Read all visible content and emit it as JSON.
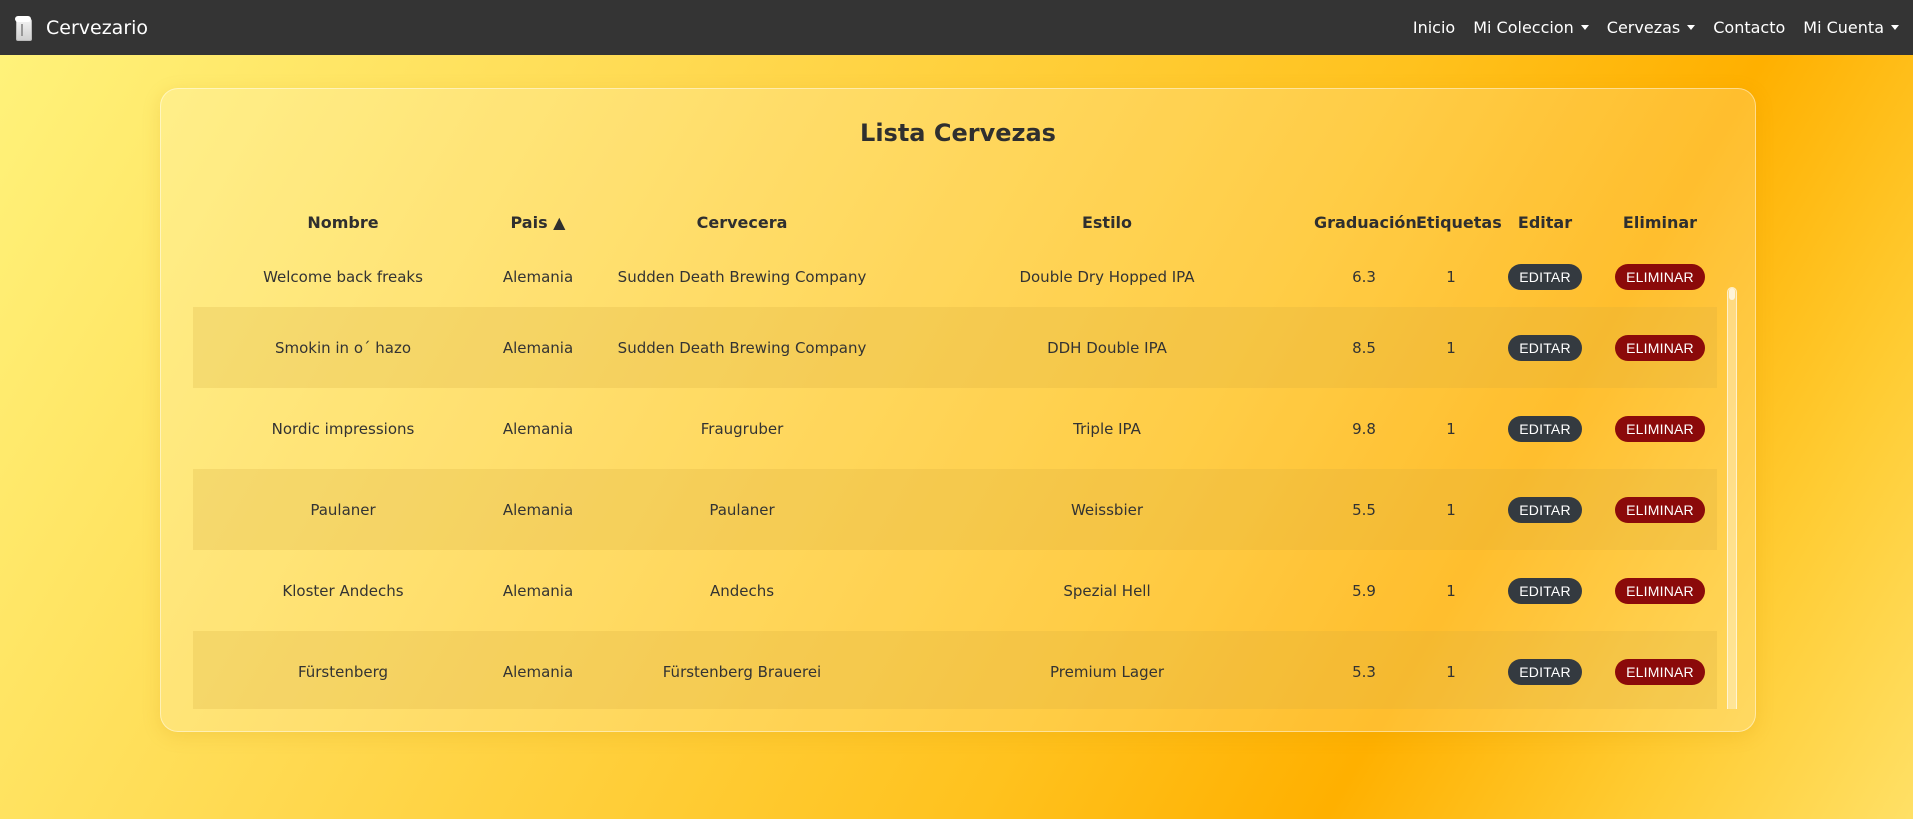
{
  "navbar": {
    "brand": "Cervezario",
    "links": [
      {
        "label": "Inicio",
        "dropdown": false
      },
      {
        "label": "Mi Coleccion",
        "dropdown": true
      },
      {
        "label": "Cervezas",
        "dropdown": true
      },
      {
        "label": "Contacto",
        "dropdown": false
      },
      {
        "label": "Mi Cuenta",
        "dropdown": true
      }
    ]
  },
  "page": {
    "title": "Lista Cervezas",
    "columns": [
      "Nombre",
      "Pais ▲",
      "Cervecera",
      "Estilo",
      "Graduación",
      "Etiquetas",
      "Editar",
      "Eliminar"
    ],
    "edit_label": "EDITAR",
    "delete_label": "ELIMINAR",
    "rows": [
      {
        "nombre": "Welcome back freaks",
        "pais": "Alemania",
        "cervecera": "Sudden Death Brewing Company",
        "estilo": "Double Dry Hopped IPA",
        "graduacion": "6.3",
        "etiquetas": "1"
      },
      {
        "nombre": "Smokin in o´ hazo",
        "pais": "Alemania",
        "cervecera": "Sudden Death Brewing Company",
        "estilo": "DDH Double IPA",
        "graduacion": "8.5",
        "etiquetas": "1"
      },
      {
        "nombre": "Nordic impressions",
        "pais": "Alemania",
        "cervecera": "Fraugruber",
        "estilo": "Triple IPA",
        "graduacion": "9.8",
        "etiquetas": "1"
      },
      {
        "nombre": "Paulaner",
        "pais": "Alemania",
        "cervecera": "Paulaner",
        "estilo": "Weissbier",
        "graduacion": "5.5",
        "etiquetas": "1"
      },
      {
        "nombre": "Kloster Andechs",
        "pais": "Alemania",
        "cervecera": "Andechs",
        "estilo": "Spezial Hell",
        "graduacion": "5.9",
        "etiquetas": "1"
      },
      {
        "nombre": "Fürstenberg",
        "pais": "Alemania",
        "cervecera": "Fürstenberg Brauerei",
        "estilo": "Premium Lager",
        "graduacion": "5.3",
        "etiquetas": "1"
      }
    ]
  },
  "colors": {
    "navbar": "#343434",
    "edit_button": "#343a40",
    "delete_button": "#8b0a0a"
  }
}
